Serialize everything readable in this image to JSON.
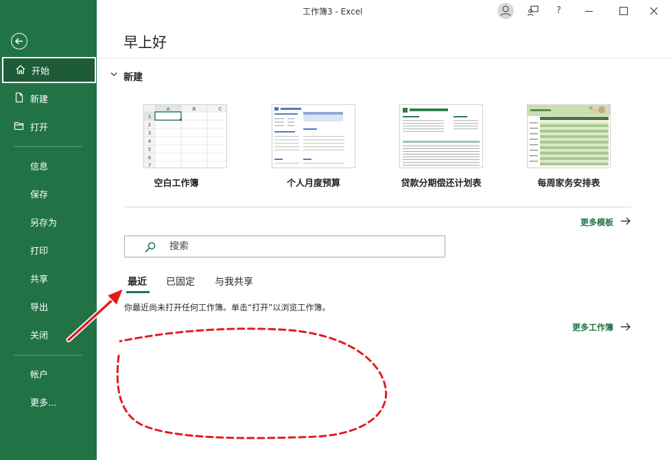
{
  "window": {
    "title": "工作簿3  -  Excel",
    "controls": [
      "account-icon",
      "feedback-icon",
      "help-icon",
      "minimize-icon",
      "maximize-icon",
      "close-icon"
    ],
    "help_glyph": "?"
  },
  "sidebar": {
    "items": [
      {
        "label": "开始",
        "icon": "home-icon",
        "active": true
      },
      {
        "label": "新建",
        "icon": "new-document-icon"
      },
      {
        "label": "打开",
        "icon": "open-folder-icon"
      },
      {
        "label": "信息"
      },
      {
        "label": "保存"
      },
      {
        "label": "另存为"
      },
      {
        "label": "打印"
      },
      {
        "label": "共享"
      },
      {
        "label": "导出"
      },
      {
        "label": "关闭"
      },
      {
        "label": "帐户"
      },
      {
        "label": "更多..."
      }
    ]
  },
  "main": {
    "greeting": "早上好",
    "new_section": {
      "heading": "新建",
      "templates": [
        {
          "label": "空白工作簿"
        },
        {
          "label": "个人月度预算"
        },
        {
          "label": "贷款分期偿还计划表"
        },
        {
          "label": "每周家务安排表"
        }
      ],
      "more_templates": "更多模板"
    },
    "search": {
      "placeholder": "搜索"
    },
    "tabs": [
      {
        "label": "最近",
        "active": true
      },
      {
        "label": "已固定"
      },
      {
        "label": "与我共享"
      }
    ],
    "empty_message": "你最近尚未打开任何工作簿。单击“打开”以浏览工作簿。",
    "more_workbooks": "更多工作簿"
  },
  "blank_thumb": {
    "columns": [
      "A",
      "B",
      "C"
    ],
    "rows": [
      "1",
      "2",
      "3",
      "4",
      "5",
      "6",
      "7"
    ]
  },
  "colors": {
    "accent": "#217346",
    "active_nav": "#1e5b38",
    "annotation": "#e31b1b"
  }
}
